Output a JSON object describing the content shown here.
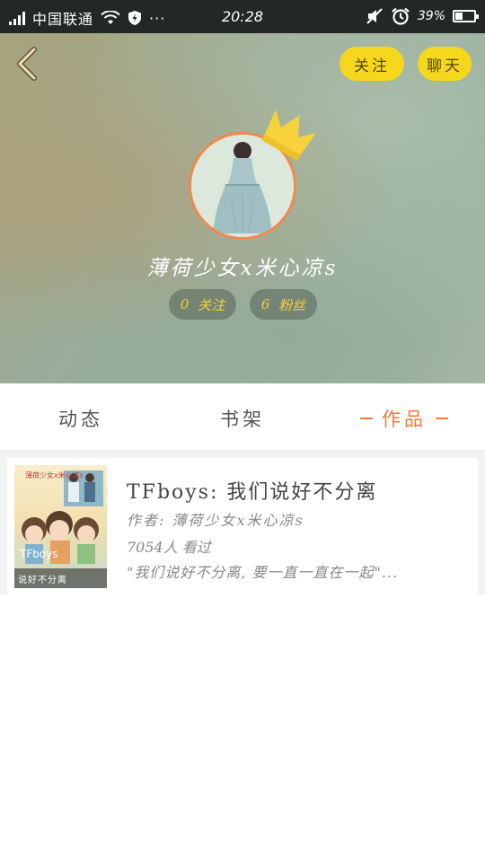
{
  "status_bar": {
    "carrier": "中国联通",
    "dots": "···",
    "time": "20:28",
    "battery": "39%",
    "battery_level": 0.39,
    "icons": [
      "signal-icon",
      "wifi-icon",
      "shield-icon",
      "mute-icon",
      "alarm-icon",
      "battery-icon"
    ]
  },
  "header": {
    "back_icon": "chevron-left-icon",
    "follow_label": "关注",
    "chat_label": "聊天",
    "username": "薄荷少女x米心凉s",
    "stats": {
      "follow_count": "0",
      "follow_label": "关注",
      "fans_count": "6",
      "fans_label": "粉丝"
    },
    "accent_color": "#f5d71d"
  },
  "tabs": [
    {
      "label": "动态"
    },
    {
      "label": "书架"
    },
    {
      "label": "作品",
      "active": true
    }
  ],
  "works": [
    {
      "cover_text": "说好不分离",
      "cover_title": "薄荷少女x米心凉s",
      "cover_brand": "TFboys",
      "title": "TFboys: 我们说好不分离",
      "author": "作者: 薄荷少女x米心凉s",
      "views": "7054人 看过",
      "description": "\"我们说好不分离, 要一直一直在一起\"..."
    }
  ],
  "colors": {
    "active_tab": "#f07a3a",
    "avatar_border": "#ef8a4d",
    "status_bar_bg": "#232826"
  }
}
